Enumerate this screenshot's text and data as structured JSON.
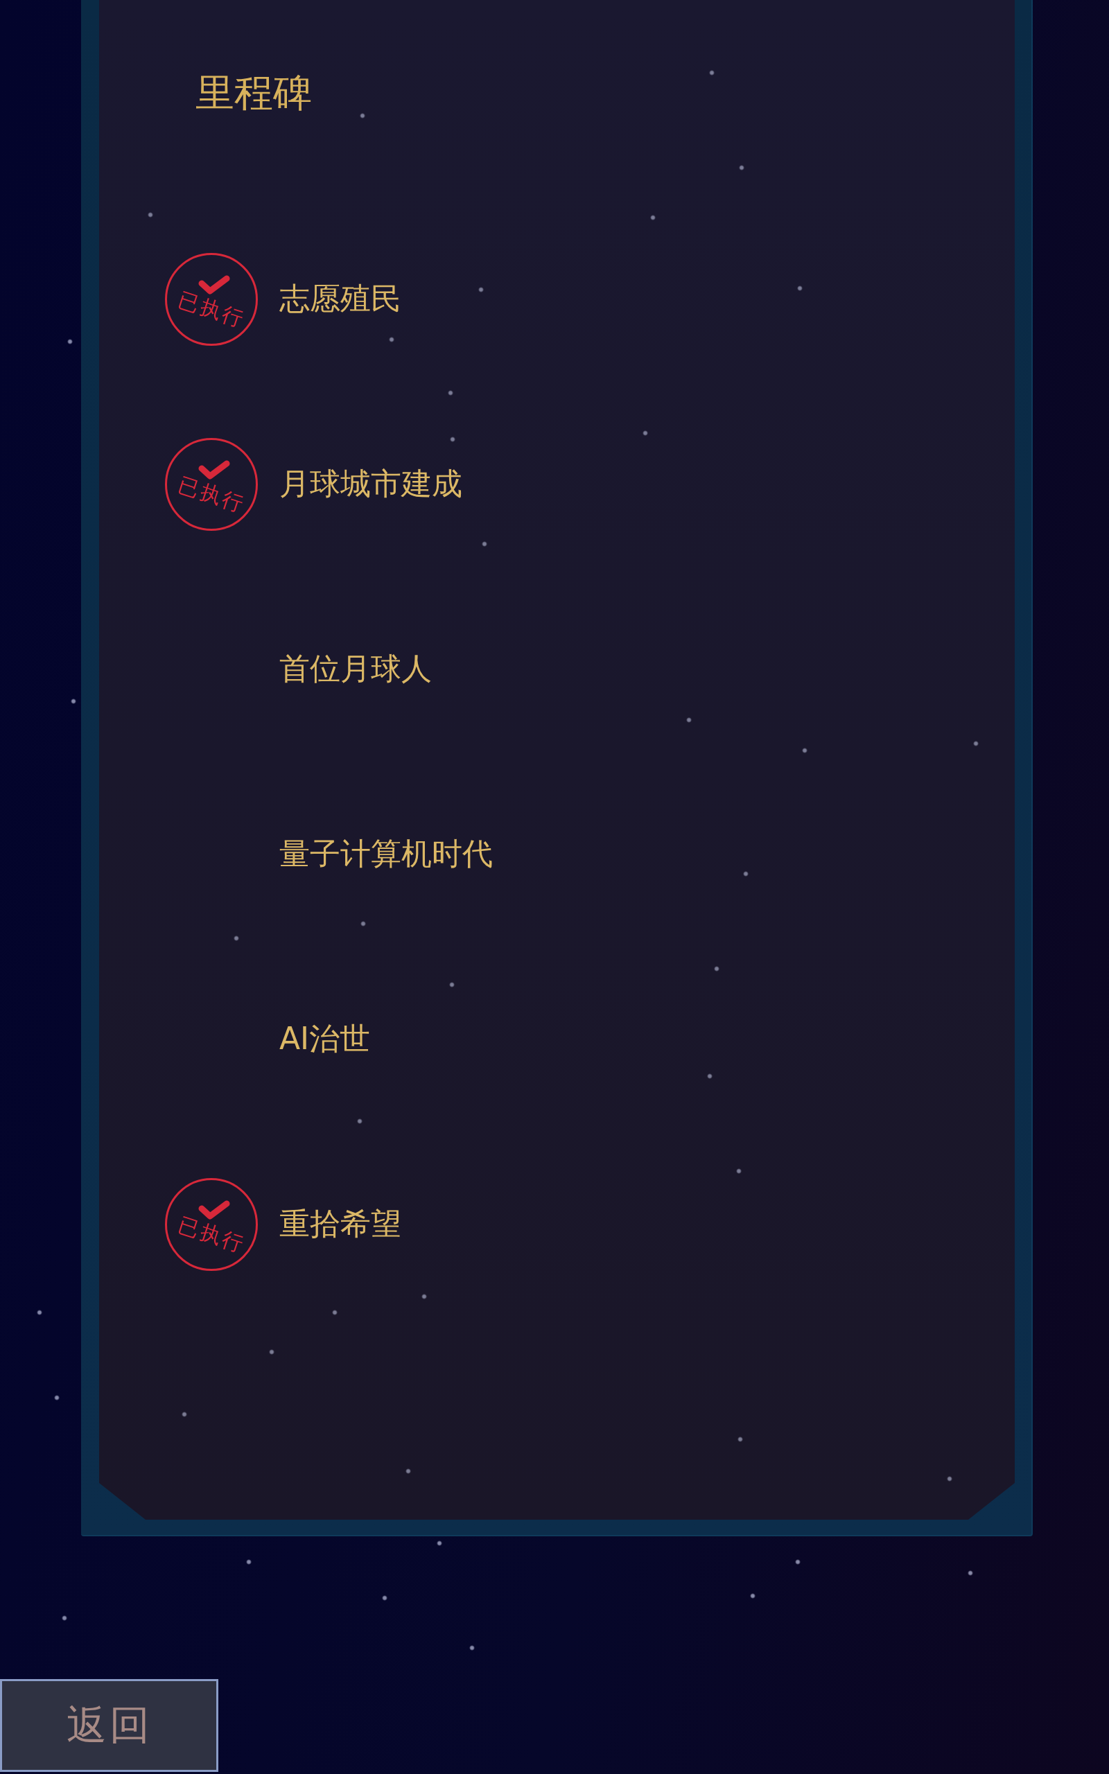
{
  "panel": {
    "title": "里程碑",
    "milestones": [
      {
        "title": "志愿殖民",
        "executed": true,
        "stamp_text": "已执行"
      },
      {
        "title": "月球城市建成",
        "executed": true,
        "stamp_text": "已执行"
      },
      {
        "title": "首位月球人",
        "executed": false
      },
      {
        "title": "量子计算机时代",
        "executed": false
      },
      {
        "title": "AI治世",
        "executed": false
      },
      {
        "title": "重拾希望",
        "executed": true,
        "stamp_text": "已执行"
      }
    ]
  },
  "back_button": {
    "label": "返回"
  }
}
